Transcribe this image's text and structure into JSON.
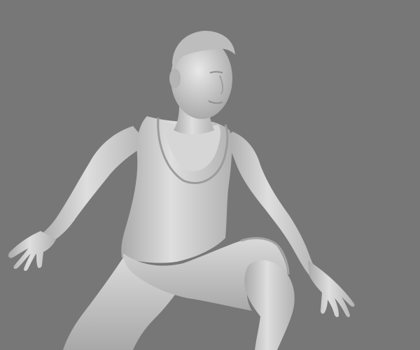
{
  "scene": {
    "background_color": "#777777",
    "model_color": "#c9c9c9",
    "shadow_color": "#9a9a9a",
    "highlight_color": "#e6e6e6"
  }
}
